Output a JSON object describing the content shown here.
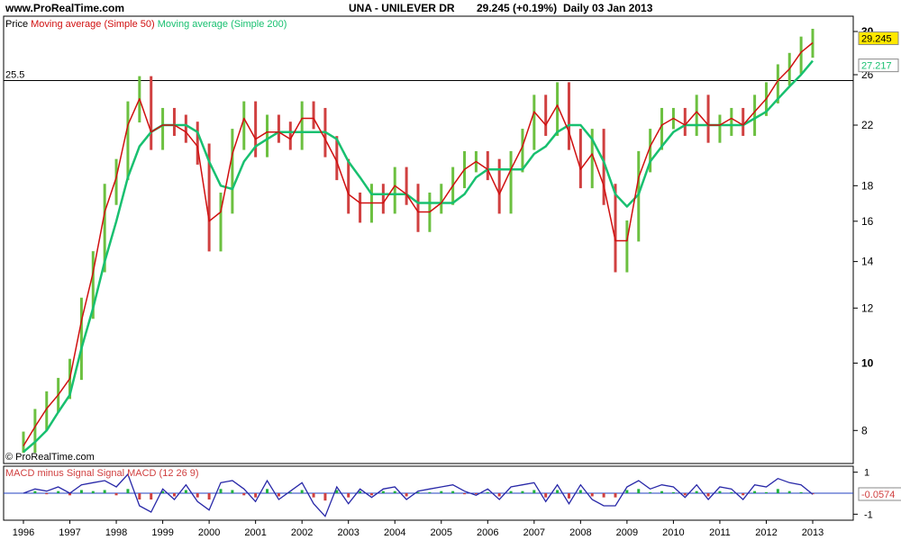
{
  "header": {
    "site": "www.ProRealTime.com",
    "symbol": "UNA - UNILEVER DR",
    "last": "29.245 (+0.19%)",
    "period": "Daily  03 Jan 2013"
  },
  "colors": {
    "ma50": "#d01010",
    "ma200": "#18c070",
    "price_up": "#6cc040",
    "price_down": "#d04040",
    "macd_line": "#2828a8",
    "macd_hist": "#d04040",
    "hist_green": "#20b040",
    "zero_line": "#2040c0",
    "last_price_bg": "#ffe800"
  },
  "chart_data": [
    {
      "type": "line",
      "title": "UNA - UNILEVER DR",
      "legend": [
        "Price",
        "Moving average (Simple 50)",
        "Moving average (Simple 200)"
      ],
      "y_scale": "log",
      "ylim": [
        7.3,
        31
      ],
      "y_ticks": [
        8,
        10,
        12,
        14,
        16,
        18,
        22,
        26,
        30
      ],
      "x_ticks": [
        "1996",
        "1997",
        "1998",
        "1999",
        "2000",
        "2001",
        "2002",
        "2003",
        "2004",
        "2005",
        "2006",
        "2007",
        "2008",
        "2009",
        "2010",
        "2011",
        "2012",
        "2013"
      ],
      "horizontal_line": {
        "label": "25.5",
        "value": 25.5
      },
      "last_price_label": "29.245",
      "ma200_label": "27.217",
      "watermark": "© ProRealTime.com",
      "series": [
        {
          "name": "Price",
          "x": [
            1996.0,
            1996.25,
            1996.5,
            1996.75,
            1997.0,
            1997.25,
            1997.5,
            1997.75,
            1998.0,
            1998.25,
            1998.5,
            1998.75,
            1999.0,
            1999.25,
            1999.5,
            1999.75,
            2000.0,
            2000.25,
            2000.5,
            2000.75,
            2001.0,
            2001.25,
            2001.5,
            2001.75,
            2002.0,
            2002.25,
            2002.5,
            2002.75,
            2003.0,
            2003.25,
            2003.5,
            2003.75,
            2004.0,
            2004.25,
            2004.5,
            2004.75,
            2005.0,
            2005.25,
            2005.5,
            2005.75,
            2006.0,
            2006.25,
            2006.5,
            2006.75,
            2007.0,
            2007.25,
            2007.5,
            2007.75,
            2008.0,
            2008.25,
            2008.5,
            2008.75,
            2009.0,
            2009.25,
            2009.5,
            2009.75,
            2010.0,
            2010.25,
            2010.5,
            2010.75,
            2011.0,
            2011.25,
            2011.5,
            2011.75,
            2012.0,
            2012.25,
            2012.5,
            2012.75,
            2013.0
          ],
          "values": [
            7.7,
            8.3,
            8.8,
            9.2,
            9.8,
            12.0,
            14.0,
            17.5,
            19.0,
            23.0,
            25.0,
            21.0,
            22.5,
            22.0,
            21.5,
            20.0,
            15.0,
            17.0,
            21.0,
            23.0,
            20.5,
            22.0,
            21.5,
            21.0,
            23.0,
            22.5,
            20.5,
            19.0,
            17.0,
            16.5,
            17.5,
            17.0,
            18.5,
            17.5,
            16.0,
            17.0,
            17.5,
            18.5,
            19.5,
            19.5,
            19.0,
            17.0,
            19.5,
            21.0,
            23.5,
            22.0,
            24.5,
            21.0,
            18.5,
            21.0,
            17.5,
            14.0,
            15.5,
            19.5,
            21.0,
            22.5,
            22.5,
            22.0,
            23.5,
            21.5,
            22.0,
            22.5,
            22.0,
            23.5,
            24.5,
            26.0,
            27.0,
            28.5,
            29.245
          ]
        },
        {
          "name": "Moving average (Simple 50)",
          "x": [
            1996.0,
            1996.25,
            1996.5,
            1996.75,
            1997.0,
            1997.25,
            1997.5,
            1997.75,
            1998.0,
            1998.25,
            1998.5,
            1998.75,
            1999.0,
            1999.25,
            1999.5,
            1999.75,
            2000.0,
            2000.25,
            2000.5,
            2000.75,
            2001.0,
            2001.25,
            2001.5,
            2001.75,
            2002.0,
            2002.25,
            2002.5,
            2002.75,
            2003.0,
            2003.25,
            2003.5,
            2003.75,
            2004.0,
            2004.25,
            2004.5,
            2004.75,
            2005.0,
            2005.25,
            2005.5,
            2005.75,
            2006.0,
            2006.25,
            2006.5,
            2006.75,
            2007.0,
            2007.25,
            2007.5,
            2007.75,
            2008.0,
            2008.25,
            2008.5,
            2008.75,
            2009.0,
            2009.25,
            2009.5,
            2009.75,
            2010.0,
            2010.25,
            2010.5,
            2010.75,
            2011.0,
            2011.25,
            2011.5,
            2011.75,
            2012.0,
            2012.25,
            2012.5,
            2012.75,
            2013.0
          ],
          "values": [
            7.6,
            8.1,
            8.6,
            9.0,
            9.5,
            11.5,
            13.5,
            16.5,
            18.5,
            22.0,
            24.0,
            21.5,
            22.0,
            22.0,
            21.5,
            20.5,
            16.0,
            16.5,
            20.0,
            22.5,
            21.0,
            21.5,
            21.5,
            21.0,
            22.5,
            22.5,
            21.0,
            19.5,
            17.5,
            17.0,
            17.0,
            17.0,
            18.0,
            17.5,
            16.5,
            16.5,
            17.0,
            18.0,
            19.0,
            19.5,
            19.0,
            17.5,
            19.0,
            20.5,
            23.0,
            22.0,
            23.5,
            21.5,
            19.0,
            20.0,
            18.0,
            15.0,
            15.0,
            18.5,
            20.5,
            22.0,
            22.5,
            22.0,
            23.0,
            22.0,
            22.0,
            22.5,
            22.0,
            23.0,
            24.0,
            25.5,
            26.5,
            28.0,
            28.9
          ]
        },
        {
          "name": "Moving average (Simple 200)",
          "x": [
            1996.0,
            1996.25,
            1996.5,
            1996.75,
            1997.0,
            1997.25,
            1997.5,
            1997.75,
            1998.0,
            1998.25,
            1998.5,
            1998.75,
            1999.0,
            1999.25,
            1999.5,
            1999.75,
            2000.0,
            2000.25,
            2000.5,
            2000.75,
            2001.0,
            2001.25,
            2001.5,
            2001.75,
            2002.0,
            2002.25,
            2002.5,
            2002.75,
            2003.0,
            2003.25,
            2003.5,
            2003.75,
            2004.0,
            2004.25,
            2004.5,
            2004.75,
            2005.0,
            2005.25,
            2005.5,
            2005.75,
            2006.0,
            2006.25,
            2006.5,
            2006.75,
            2007.0,
            2007.25,
            2007.5,
            2007.75,
            2008.0,
            2008.25,
            2008.5,
            2008.75,
            2009.0,
            2009.25,
            2009.5,
            2009.75,
            2010.0,
            2010.25,
            2010.5,
            2010.75,
            2011.0,
            2011.25,
            2011.5,
            2011.75,
            2012.0,
            2012.25,
            2012.5,
            2012.75,
            2013.0
          ],
          "values": [
            7.45,
            7.7,
            8.0,
            8.5,
            9.0,
            10.5,
            12.0,
            14.0,
            16.0,
            18.5,
            20.5,
            21.5,
            22.0,
            22.0,
            22.0,
            21.5,
            19.5,
            18.0,
            17.8,
            19.5,
            20.5,
            21.0,
            21.5,
            21.5,
            21.5,
            21.5,
            21.5,
            21.0,
            19.5,
            18.5,
            17.5,
            17.5,
            17.5,
            17.5,
            17.0,
            17.0,
            17.0,
            17.0,
            17.5,
            18.5,
            19.0,
            19.0,
            19.0,
            19.0,
            20.0,
            20.5,
            21.5,
            22.0,
            22.0,
            21.0,
            19.5,
            17.5,
            16.8,
            17.5,
            19.5,
            20.5,
            21.5,
            22.0,
            22.0,
            22.0,
            22.0,
            22.0,
            22.0,
            22.5,
            23.0,
            24.0,
            25.0,
            26.0,
            27.217
          ]
        }
      ]
    },
    {
      "type": "line",
      "title": "MACD minus Signal Signal MACD (12 26 9)",
      "ylim": [
        -1.2,
        1.2
      ],
      "y_ticks": [
        1,
        -1
      ],
      "zero_line": 0,
      "last_value_label": "-0.0574",
      "series": [
        {
          "name": "MACD (12 26 9)",
          "x": [
            1996.0,
            1996.25,
            1996.5,
            1996.75,
            1997.0,
            1997.25,
            1997.5,
            1997.75,
            1998.0,
            1998.25,
            1998.5,
            1998.75,
            1999.0,
            1999.25,
            1999.5,
            1999.75,
            2000.0,
            2000.25,
            2000.5,
            2000.75,
            2001.0,
            2001.25,
            2001.5,
            2001.75,
            2002.0,
            2002.25,
            2002.5,
            2002.75,
            2003.0,
            2003.25,
            2003.5,
            2003.75,
            2004.0,
            2004.25,
            2004.5,
            2004.75,
            2005.0,
            2005.25,
            2005.5,
            2005.75,
            2006.0,
            2006.25,
            2006.5,
            2006.75,
            2007.0,
            2007.25,
            2007.5,
            2007.75,
            2008.0,
            2008.25,
            2008.5,
            2008.75,
            2009.0,
            2009.25,
            2009.5,
            2009.75,
            2010.0,
            2010.25,
            2010.5,
            2010.75,
            2011.0,
            2011.25,
            2011.5,
            2011.75,
            2012.0,
            2012.25,
            2012.5,
            2012.75,
            2013.0
          ],
          "values": [
            0.0,
            0.2,
            0.1,
            0.3,
            0.0,
            0.4,
            0.5,
            0.6,
            0.3,
            0.9,
            -0.6,
            -0.9,
            0.2,
            -0.3,
            0.4,
            -0.4,
            -0.8,
            0.5,
            0.6,
            0.2,
            -0.4,
            0.6,
            -0.3,
            0.1,
            0.5,
            -0.5,
            -1.1,
            0.3,
            -0.5,
            0.2,
            -0.2,
            0.2,
            0.3,
            -0.3,
            0.1,
            0.2,
            0.3,
            0.4,
            0.1,
            -0.1,
            0.2,
            -0.3,
            0.3,
            0.4,
            0.5,
            -0.4,
            0.4,
            -0.5,
            0.4,
            -0.3,
            -0.6,
            -0.6,
            0.3,
            0.6,
            0.2,
            0.4,
            0.3,
            -0.2,
            0.4,
            -0.3,
            0.3,
            0.2,
            -0.3,
            0.4,
            0.3,
            0.7,
            0.5,
            0.4,
            -0.0574
          ]
        },
        {
          "name": "MACD minus Signal",
          "x": [
            1996.0,
            1996.25,
            1996.5,
            1996.75,
            1997.0,
            1997.25,
            1997.5,
            1997.75,
            1998.0,
            1998.25,
            1998.5,
            1998.75,
            1999.0,
            1999.25,
            1999.5,
            1999.75,
            2000.0,
            2000.25,
            2000.5,
            2000.75,
            2001.0,
            2001.25,
            2001.5,
            2001.75,
            2002.0,
            2002.25,
            2002.5,
            2002.75,
            2003.0,
            2003.25,
            2003.5,
            2003.75,
            2004.0,
            2004.25,
            2004.5,
            2004.75,
            2005.0,
            2005.25,
            2005.5,
            2005.75,
            2006.0,
            2006.25,
            2006.5,
            2006.75,
            2007.0,
            2007.25,
            2007.5,
            2007.75,
            2008.0,
            2008.25,
            2008.5,
            2008.75,
            2009.0,
            2009.25,
            2009.5,
            2009.75,
            2010.0,
            2010.25,
            2010.5,
            2010.75,
            2011.0,
            2011.25,
            2011.5,
            2011.75,
            2012.0,
            2012.25,
            2012.5,
            2012.75,
            2013.0
          ],
          "values": [
            0.0,
            0.1,
            -0.05,
            0.1,
            -0.1,
            0.15,
            0.1,
            0.15,
            -0.1,
            0.2,
            -0.3,
            -0.3,
            0.1,
            -0.15,
            0.15,
            -0.2,
            -0.3,
            0.2,
            0.15,
            -0.1,
            -0.2,
            0.2,
            -0.15,
            0.05,
            0.15,
            -0.2,
            -0.35,
            0.15,
            -0.2,
            0.1,
            -0.1,
            0.1,
            0.1,
            -0.15,
            0.05,
            0.05,
            0.1,
            0.1,
            -0.05,
            -0.05,
            0.05,
            -0.15,
            0.1,
            0.1,
            0.15,
            -0.2,
            0.15,
            -0.25,
            0.15,
            -0.15,
            -0.2,
            -0.2,
            0.15,
            0.2,
            0.05,
            0.1,
            0.05,
            -0.1,
            0.1,
            -0.15,
            0.1,
            0.05,
            -0.1,
            0.1,
            0.05,
            0.2,
            0.1,
            0.05,
            -0.05
          ]
        }
      ]
    }
  ]
}
